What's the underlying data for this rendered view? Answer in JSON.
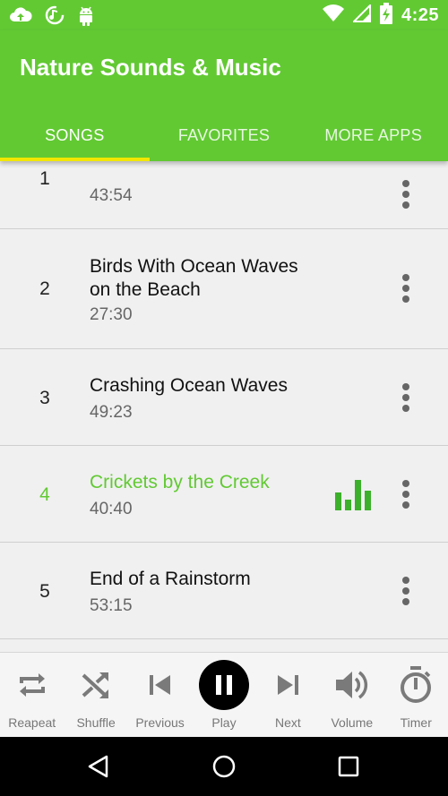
{
  "status_bar": {
    "time": "4:25",
    "left_icons": [
      "cloud-upload-icon",
      "music-settings-icon",
      "android-icon"
    ],
    "right_icons": [
      "wifi-icon",
      "signal-icon",
      "battery-icon"
    ]
  },
  "app": {
    "title": "Nature Sounds & Music",
    "tabs": [
      {
        "label": "SONGS",
        "active": true
      },
      {
        "label": "FAVORITES",
        "active": false
      },
      {
        "label": "MORE APPS",
        "active": false
      }
    ]
  },
  "songs": [
    {
      "number": "1",
      "title": "",
      "duration": "43:54",
      "playing": false
    },
    {
      "number": "2",
      "title": "Birds With Ocean Waves on the Beach",
      "duration": "27:30",
      "playing": false
    },
    {
      "number": "3",
      "title": "Crashing Ocean Waves",
      "duration": "49:23",
      "playing": false
    },
    {
      "number": "4",
      "title": "Crickets by the Creek",
      "duration": "40:40",
      "playing": true
    },
    {
      "number": "5",
      "title": "End of a Rainstorm",
      "duration": "53:15",
      "playing": false
    }
  ],
  "player": {
    "repeat_label": "Reapeat",
    "shuffle_label": "Shuffle",
    "previous_label": "Previous",
    "play_label": "Play",
    "next_label": "Next",
    "volume_label": "Volume",
    "timer_label": "Timer"
  },
  "colors": {
    "accent": "#62c933",
    "tab_indicator": "#f2e600",
    "playing_text": "#62c933",
    "equalizer": "#3cb02a"
  }
}
